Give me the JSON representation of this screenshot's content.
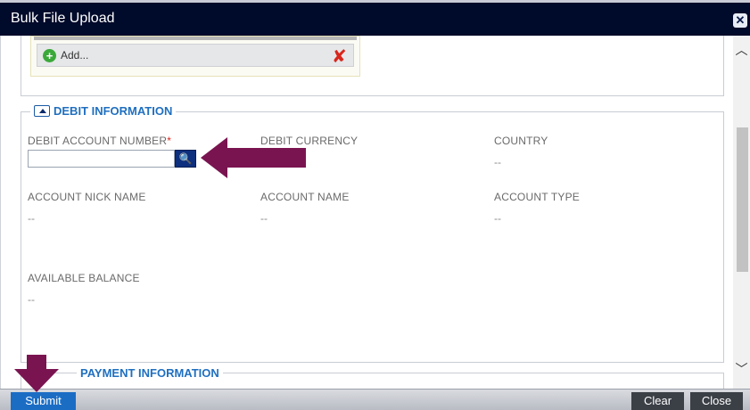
{
  "window": {
    "title": "Bulk File Upload"
  },
  "upload": {
    "add_label": "Add..."
  },
  "debit_section": {
    "title": "DEBIT INFORMATION",
    "fields": {
      "debit_account_number": {
        "label": "DEBIT ACCOUNT NUMBER",
        "required_mark": "*",
        "value": ""
      },
      "debit_currency": {
        "label": "DEBIT CURRENCY",
        "value": ""
      },
      "country": {
        "label": "COUNTRY",
        "value": "--"
      },
      "account_nick_name": {
        "label": "ACCOUNT NICK NAME",
        "value": "--"
      },
      "account_name": {
        "label": "ACCOUNT NAME",
        "value": "--"
      },
      "account_type": {
        "label": "ACCOUNT TYPE",
        "value": "--"
      },
      "available_balance": {
        "label": "AVAILABLE BALANCE",
        "value": "--"
      }
    }
  },
  "payment_section": {
    "title": "PAYMENT INFORMATION"
  },
  "footer": {
    "submit_label": "Submit",
    "clear_label": "Clear",
    "close_label": "Close"
  },
  "colors": {
    "title_bar": "#000a2a",
    "accent": "#1f6fc0",
    "submit": "#1b6dc4",
    "annotation_arrow": "#7a1450",
    "required": "#d9261c"
  },
  "icons": [
    "close-icon",
    "add-icon",
    "remove-icon",
    "collapse-icon",
    "search-icon",
    "scroll-up-icon",
    "scroll-down-icon"
  ]
}
